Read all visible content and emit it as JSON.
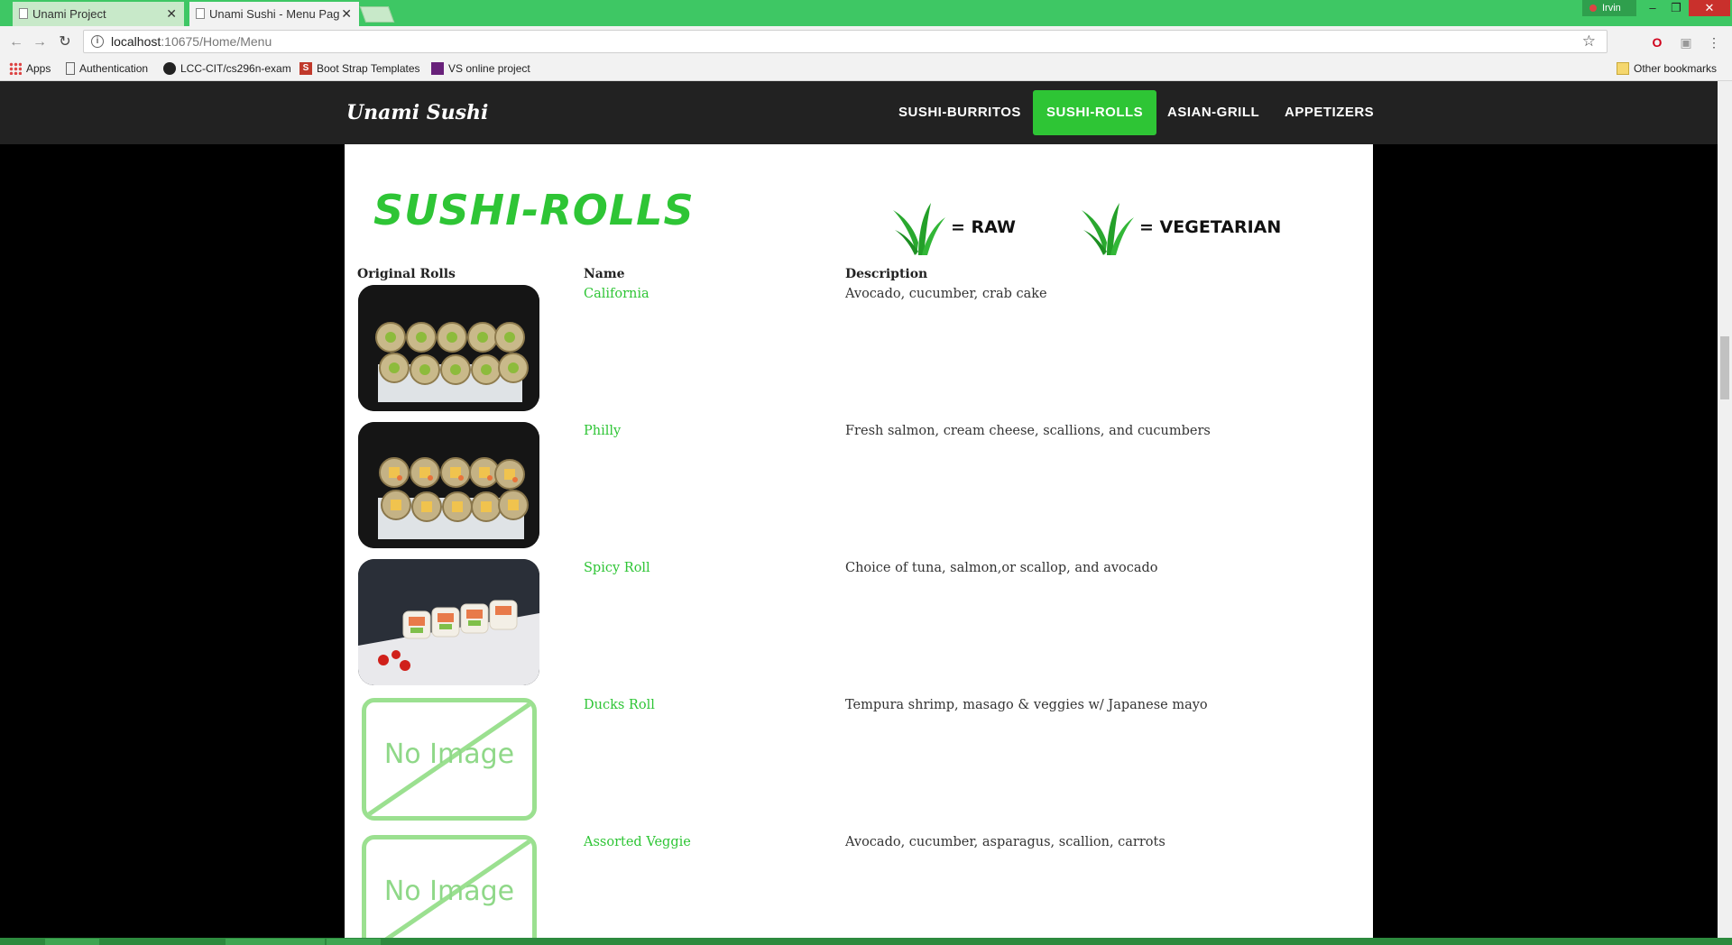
{
  "browser": {
    "tabs": [
      {
        "title": "Unami Project",
        "active": false
      },
      {
        "title": "Unami Sushi - Menu Pag",
        "active": true
      }
    ],
    "profile_name": "Irvin",
    "url_host": "localhost",
    "url_path": ":10675/Home/Menu",
    "bookmarks": [
      "Apps",
      "Authentication",
      "LCC-CIT/cs296n-exam",
      "Boot Strap Templates",
      "VS online project"
    ],
    "other_bookmarks": "Other bookmarks"
  },
  "site": {
    "brand": "Unami Sushi",
    "nav": [
      {
        "label": "SUSHI-BURRITOS",
        "active": false
      },
      {
        "label": "SUSHI-ROLLS",
        "active": true
      },
      {
        "label": "ASIAN-GRILL",
        "active": false
      },
      {
        "label": "APPETIZERS",
        "active": false
      }
    ]
  },
  "menu": {
    "title": "SUSHI-ROLLS",
    "legend": [
      {
        "icon": "grass-icon",
        "text": "= RAW"
      },
      {
        "icon": "grass-icon",
        "text": "= VEGETARIAN"
      }
    ],
    "columns": {
      "section": "Original Rolls",
      "name": "Name",
      "description": "Description"
    },
    "items": [
      {
        "name": "California",
        "description": "Avocado, cucumber, crab cake",
        "image": "california-roll"
      },
      {
        "name": "Philly",
        "description": "Fresh salmon, cream cheese, scallions, and cucumbers",
        "image": "philly-roll"
      },
      {
        "name": "Spicy Roll",
        "description": "Choice of tuna, salmon,or scallop, and avocado",
        "image": "spicy-roll"
      },
      {
        "name": "Ducks Roll",
        "description": "Tempura shrimp, masago & veggies w/ Japanese mayo",
        "image": "none"
      },
      {
        "name": "Assorted Veggie",
        "description": "Avocado, cucumber, asparagus, scallion, carrots",
        "image": "none"
      }
    ],
    "no_image_text": "No Image"
  },
  "colors": {
    "accent": "#2ec535",
    "nav_bg": "#222222",
    "tab_bar": "#3ec764"
  }
}
